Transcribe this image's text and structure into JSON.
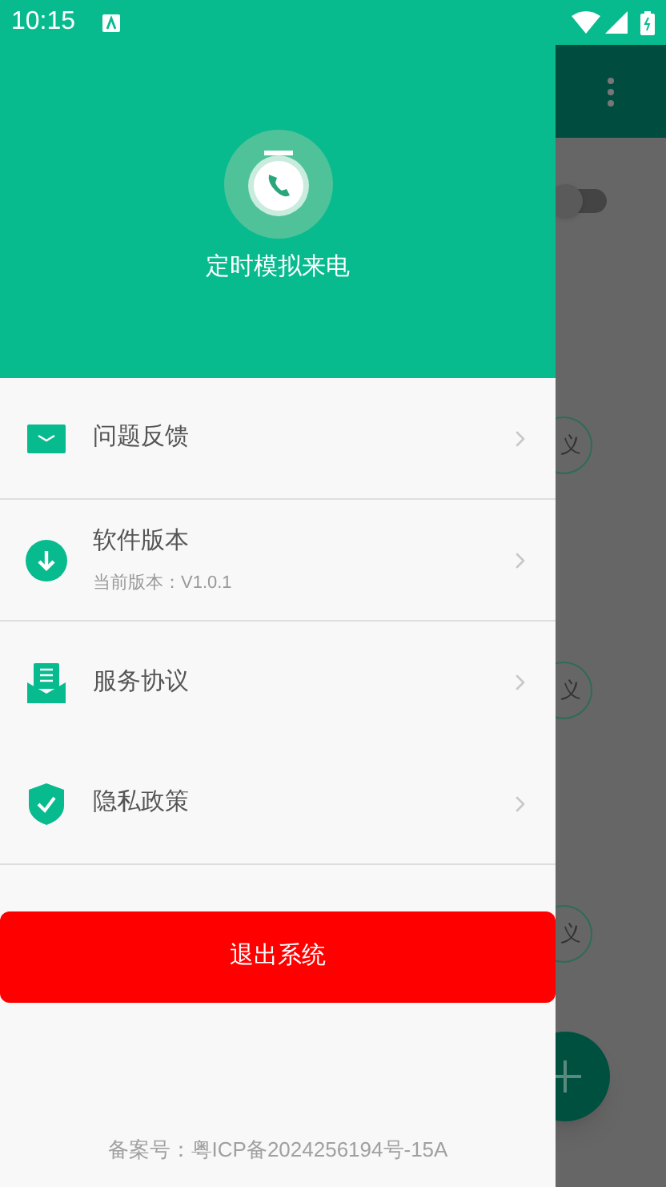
{
  "status_bar": {
    "time": "10:15"
  },
  "drawer": {
    "app_name": "定时模拟来电",
    "items": [
      {
        "kind": "mail",
        "label": "问题反馈",
        "divider": true
      },
      {
        "kind": "download",
        "label": "软件版本",
        "subtitle": "当前版本：V1.0.1",
        "divider": true
      },
      {
        "kind": "document",
        "label": "服务协议",
        "divider": false
      },
      {
        "kind": "shield",
        "label": "隐私政策",
        "divider": true
      }
    ],
    "logout_button": "退出系统",
    "footer": "备案号：粤ICP备2024256194号-15A"
  },
  "background": {
    "switch": {
      "on": false
    },
    "chips": [
      "义",
      "义",
      "义"
    ]
  }
}
